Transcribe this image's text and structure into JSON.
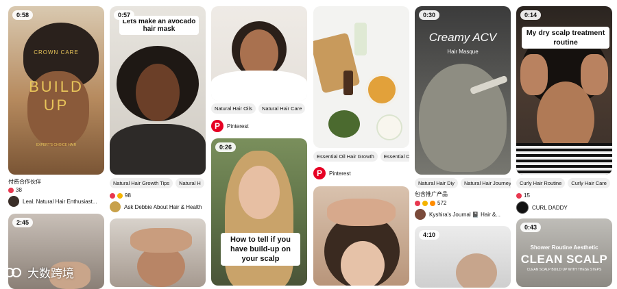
{
  "pins": [
    {
      "id": "p1",
      "duration": "0:58",
      "overlay_lines": [
        "CROWN CARE",
        "BUILD",
        "UP"
      ],
      "overlay_small": "EXPERT'S CHOICE HAIR",
      "title": "付费合作伙伴",
      "reaction_count": "38",
      "author": "Leal. Natural Hair Enthusiast..."
    },
    {
      "id": "p2",
      "duration": "2:45"
    },
    {
      "id": "p3",
      "duration": "0:57",
      "caption": "Lets make an avocado hair mask",
      "tags": [
        "Natural Hair Growth Tips",
        "Natural H"
      ],
      "reaction_count": "98",
      "author": "Ask Debbie About Hair & Health"
    },
    {
      "id": "p4"
    },
    {
      "id": "p5",
      "tags": [
        "Natural Hair Oils",
        "Natural Hair Care"
      ],
      "source": "Pinterest"
    },
    {
      "id": "p6",
      "duration": "0:26",
      "caption": "How to tell if you have build-up on your scalp"
    },
    {
      "id": "p7",
      "tags": [
        "Essential Oil Hair Growth",
        "Essential O"
      ],
      "source": "Pinterest"
    },
    {
      "id": "p8"
    },
    {
      "id": "p9",
      "duration": "0:30",
      "overlay_lines": [
        "Creamy ACV",
        "Hair Masque"
      ],
      "tags": [
        "Natural Hair Diy",
        "Natural Hair Journey"
      ],
      "title": "包含推广产品",
      "reaction_count": "572",
      "author": "Kyshira's Journal 📓 Hair &..."
    },
    {
      "id": "p10",
      "duration": "4:10"
    },
    {
      "id": "p11",
      "duration": "0:14",
      "caption": "My dry scalp treatment routine",
      "tags": [
        "Curly Hair Routine",
        "Curly Hair Care"
      ],
      "reaction_count": "15",
      "author": "CURL DADDY"
    },
    {
      "id": "p12",
      "duration": "0:43",
      "overlay_lines": [
        "Shower Routine Aesthetic",
        "CLEAN SCALP",
        "CLEAN SCALP BUILD UP WITH THESE STEPS"
      ]
    }
  ],
  "ui": {
    "more_indicator": "›"
  },
  "watermark": {
    "text": "大数跨境"
  },
  "colors": {
    "pinterest_red": "#e60023",
    "tag_bg": "#efefef"
  }
}
